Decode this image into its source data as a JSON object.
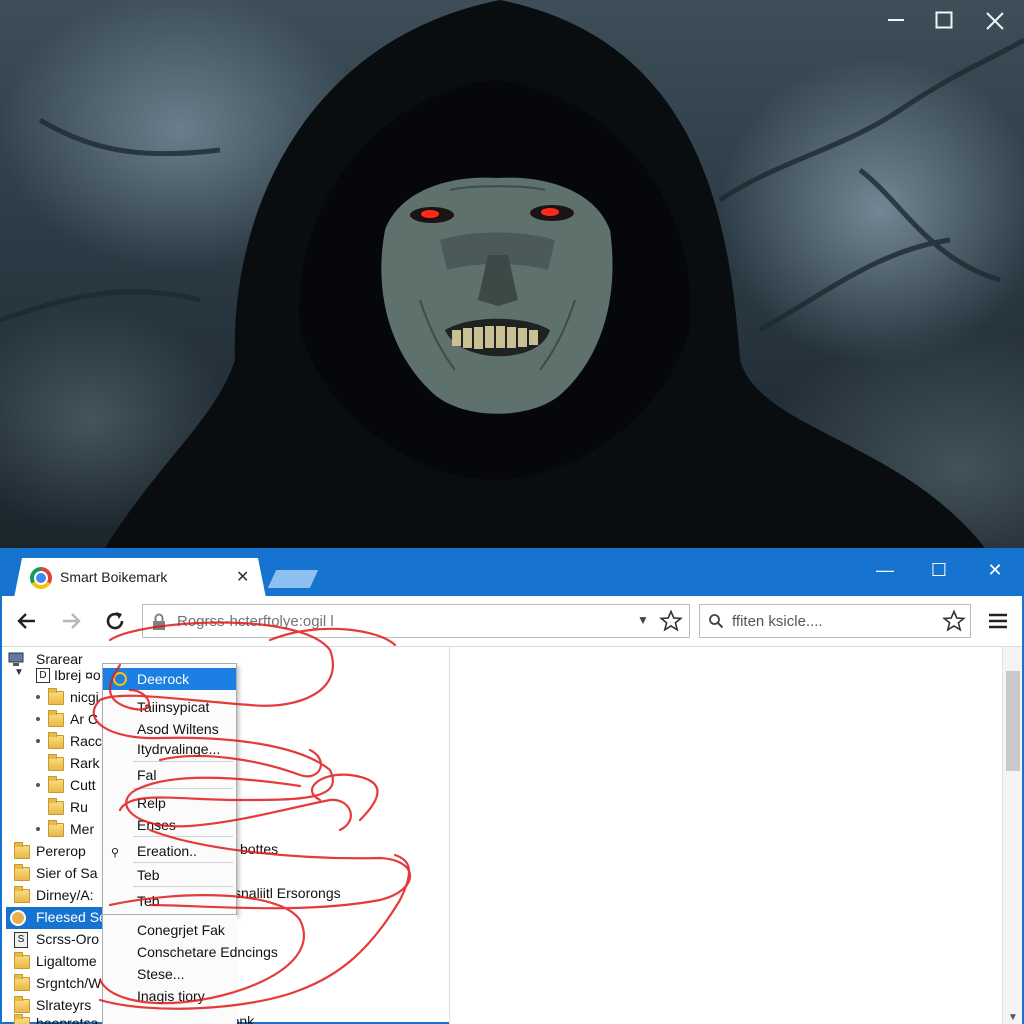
{
  "colors": {
    "accent": "#1673cf",
    "highlight": "#1c7fe3",
    "scribble": "#e01a1a",
    "folder": "#f0c75c"
  },
  "artwork": {
    "controls": [
      {
        "name": "minimize",
        "glyph": "—"
      },
      {
        "name": "maximize",
        "glyph": "☐"
      },
      {
        "name": "close",
        "glyph": "✕"
      }
    ]
  },
  "browser": {
    "tab": {
      "title": "Smart Boikemark",
      "close_glyph": "✕",
      "icon": "chrome-icon"
    },
    "window_controls": {
      "minimize": "—",
      "maximize": "☐",
      "close": "✕"
    },
    "toolbar": {
      "back_icon": "arrow-left-icon",
      "forward_icon": "arrow-right-icon",
      "reload_icon": "reload-icon",
      "address_value": "Rogrss-hcterftolye:ogil l",
      "search_placeholder": "ffiten ksicle...."
    }
  },
  "tree": {
    "rows": [
      {
        "label": "Srarear"
      },
      {
        "label": "Ibrej ¤o"
      },
      {
        "label": "nicgi"
      },
      {
        "label": "Ar C"
      },
      {
        "label": "Racc"
      },
      {
        "label": "Rark"
      },
      {
        "label": "Cutt"
      },
      {
        "label": "Ru"
      },
      {
        "label": "Mer"
      },
      {
        "label": "Pererop"
      },
      {
        "label": "Sier of Sa"
      },
      {
        "label": "Dirney/A:"
      },
      {
        "label": "Fleesed Se"
      },
      {
        "label": "Scrss-Oro"
      },
      {
        "label": "Ligaltome"
      },
      {
        "label": "Srgntch/W"
      },
      {
        "label": "Slrateyrs"
      },
      {
        "label": "heepretsa"
      }
    ],
    "overflow_texts": [
      "bottes",
      "snaliitl Ersorongs",
      "prretationk"
    ]
  },
  "context_menu": {
    "items": [
      {
        "label": "Deerock",
        "highlighted": true
      },
      {
        "label": "Taiinsypicat"
      },
      {
        "label": "Asod Wiltens"
      },
      {
        "label": "Itydrvalinge..."
      },
      {
        "label": "Fal"
      },
      {
        "label": "Relp"
      },
      {
        "label": "Enses"
      },
      {
        "label": "Ereation.."
      },
      {
        "label": "Teb"
      },
      {
        "label": "Teb"
      }
    ],
    "submenu": [
      {
        "label": "Conegrjet Fak"
      },
      {
        "label": "Conschetare Edncings"
      },
      {
        "label": "Stese..."
      },
      {
        "label": "Inagis tiory"
      }
    ]
  }
}
